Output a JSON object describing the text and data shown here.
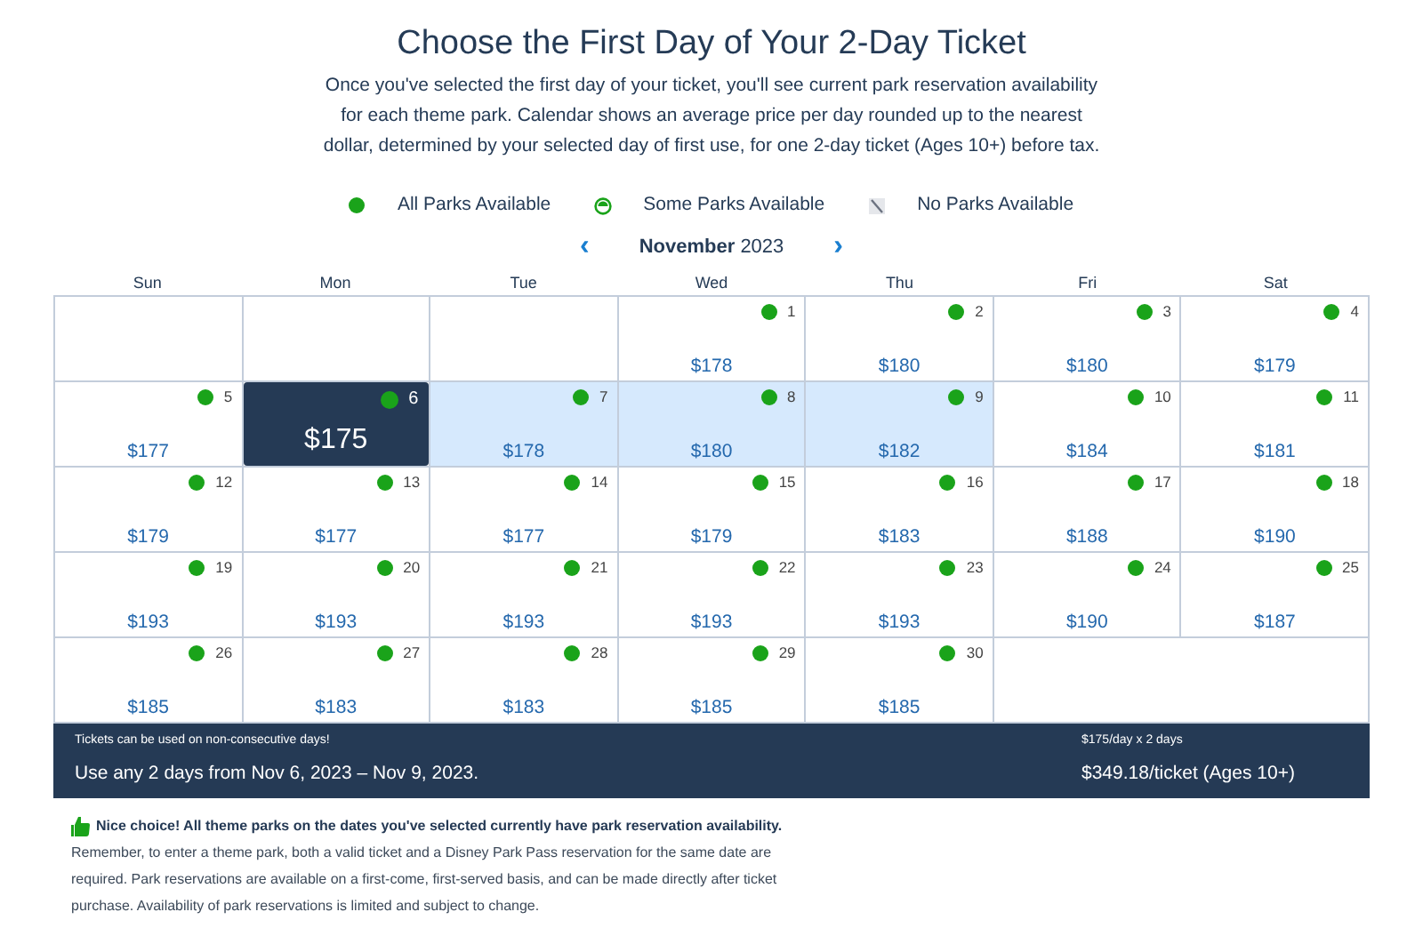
{
  "title": "Choose the First Day of Your 2-Day Ticket",
  "description": "Once you've selected the first day of your ticket, you'll see current park reservation availability for each theme park. Calendar shows an average price per day rounded up to the nearest dollar, determined by your selected day of first use, for one 2-day ticket (Ages 10+) before tax.",
  "legend": [
    {
      "kind": "all",
      "label": "All Parks Available"
    },
    {
      "kind": "some",
      "label": "Some Parks Available"
    },
    {
      "kind": "none",
      "label": "No Parks Available"
    }
  ],
  "month_nav": {
    "prev": "‹",
    "month": "November",
    "year": "2023",
    "next": "›"
  },
  "weekdays": [
    "Sun",
    "Mon",
    "Tue",
    "Wed",
    "Thu",
    "Fri",
    "Sat"
  ],
  "cells": [
    {
      "kind": "empty"
    },
    {
      "kind": "empty"
    },
    {
      "kind": "empty"
    },
    {
      "kind": "day",
      "day": "1",
      "price": "$178",
      "availability": {
        "kind": "all"
      },
      "selected": false,
      "in_range": false
    },
    {
      "kind": "day",
      "day": "2",
      "price": "$180",
      "availability": {
        "kind": "all"
      },
      "selected": false,
      "in_range": false
    },
    {
      "kind": "day",
      "day": "3",
      "price": "$180",
      "availability": {
        "kind": "all"
      },
      "selected": false,
      "in_range": false
    },
    {
      "kind": "day",
      "day": "4",
      "price": "$179",
      "availability": {
        "kind": "all"
      },
      "selected": false,
      "in_range": false
    },
    {
      "kind": "day",
      "day": "5",
      "price": "$177",
      "availability": {
        "kind": "all"
      },
      "selected": false,
      "in_range": false
    },
    {
      "kind": "day",
      "day": "6",
      "price": "$175",
      "availability": {
        "kind": "all"
      },
      "selected": true,
      "in_range": false
    },
    {
      "kind": "day",
      "day": "7",
      "price": "$178",
      "availability": {
        "kind": "all"
      },
      "selected": false,
      "in_range": true
    },
    {
      "kind": "day",
      "day": "8",
      "price": "$180",
      "availability": {
        "kind": "all"
      },
      "selected": false,
      "in_range": true
    },
    {
      "kind": "day",
      "day": "9",
      "price": "$182",
      "availability": {
        "kind": "all"
      },
      "selected": false,
      "in_range": true
    },
    {
      "kind": "day",
      "day": "10",
      "price": "$184",
      "availability": {
        "kind": "all"
      },
      "selected": false,
      "in_range": false
    },
    {
      "kind": "day",
      "day": "11",
      "price": "$181",
      "availability": {
        "kind": "all"
      },
      "selected": false,
      "in_range": false
    },
    {
      "kind": "day",
      "day": "12",
      "price": "$179",
      "availability": {
        "kind": "all"
      },
      "selected": false,
      "in_range": false
    },
    {
      "kind": "day",
      "day": "13",
      "price": "$177",
      "availability": {
        "kind": "all"
      },
      "selected": false,
      "in_range": false
    },
    {
      "kind": "day",
      "day": "14",
      "price": "$177",
      "availability": {
        "kind": "all"
      },
      "selected": false,
      "in_range": false
    },
    {
      "kind": "day",
      "day": "15",
      "price": "$179",
      "availability": {
        "kind": "all"
      },
      "selected": false,
      "in_range": false
    },
    {
      "kind": "day",
      "day": "16",
      "price": "$183",
      "availability": {
        "kind": "all"
      },
      "selected": false,
      "in_range": false
    },
    {
      "kind": "day",
      "day": "17",
      "price": "$188",
      "availability": {
        "kind": "all"
      },
      "selected": false,
      "in_range": false
    },
    {
      "kind": "day",
      "day": "18",
      "price": "$190",
      "availability": {
        "kind": "all"
      },
      "selected": false,
      "in_range": false
    },
    {
      "kind": "day",
      "day": "19",
      "price": "$193",
      "availability": {
        "kind": "all"
      },
      "selected": false,
      "in_range": false
    },
    {
      "kind": "day",
      "day": "20",
      "price": "$193",
      "availability": {
        "kind": "all"
      },
      "selected": false,
      "in_range": false
    },
    {
      "kind": "day",
      "day": "21",
      "price": "$193",
      "availability": {
        "kind": "all"
      },
      "selected": false,
      "in_range": false
    },
    {
      "kind": "day",
      "day": "22",
      "price": "$193",
      "availability": {
        "kind": "all"
      },
      "selected": false,
      "in_range": false
    },
    {
      "kind": "day",
      "day": "23",
      "price": "$193",
      "availability": {
        "kind": "all"
      },
      "selected": false,
      "in_range": false
    },
    {
      "kind": "day",
      "day": "24",
      "price": "$190",
      "availability": {
        "kind": "all"
      },
      "selected": false,
      "in_range": false
    },
    {
      "kind": "day",
      "day": "25",
      "price": "$187",
      "availability": {
        "kind": "all"
      },
      "selected": false,
      "in_range": false
    },
    {
      "kind": "day",
      "day": "26",
      "price": "$185",
      "availability": {
        "kind": "all"
      },
      "selected": false,
      "in_range": false
    },
    {
      "kind": "day",
      "day": "27",
      "price": "$183",
      "availability": {
        "kind": "all"
      },
      "selected": false,
      "in_range": false
    },
    {
      "kind": "day",
      "day": "28",
      "price": "$183",
      "availability": {
        "kind": "all"
      },
      "selected": false,
      "in_range": false
    },
    {
      "kind": "day",
      "day": "29",
      "price": "$185",
      "availability": {
        "kind": "all"
      },
      "selected": false,
      "in_range": false
    },
    {
      "kind": "day",
      "day": "30",
      "price": "$185",
      "availability": {
        "kind": "all"
      },
      "selected": false,
      "in_range": false
    }
  ],
  "summary": {
    "note": "Tickets can be used on non-consecutive days!",
    "range": "Use any 2 days from Nov 6, 2023 – Nov 9, 2023.",
    "rate": "$175/day x 2 days",
    "total": "$349.18/ticket (Ages 10+)"
  },
  "notice": {
    "headline": "Nice choice! All theme parks on the dates you've selected currently have park reservation availability.",
    "body": "Remember, to enter a theme park, both a valid ticket and a Disney Park Pass reservation for the same date are required. Park reservations are available on a first-come, first-served basis, and can be made directly after ticket purchase. Availability of park reservations is limited and subject to change."
  }
}
